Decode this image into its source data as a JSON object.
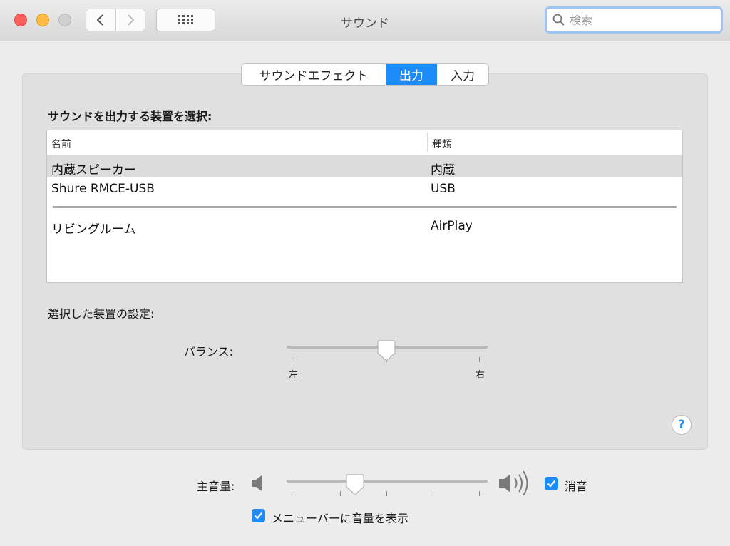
{
  "window": {
    "title": "サウンド"
  },
  "toolbar": {
    "search_placeholder": "検索"
  },
  "tabs": [
    {
      "label": "サウンドエフェクト",
      "selected": false
    },
    {
      "label": "出力",
      "selected": true
    },
    {
      "label": "入力",
      "selected": false
    }
  ],
  "output": {
    "heading": "サウンドを出力する装置を選択:",
    "columns": [
      "名前",
      "種類"
    ],
    "devices": [
      {
        "name": "内蔵スピーカー",
        "type": "内蔵",
        "selected": true
      },
      {
        "name": "Shure RMCE-USB",
        "type": "USB",
        "selected": false
      },
      {
        "name": "リビングルーム",
        "type": "AirPlay",
        "selected": false
      }
    ],
    "settings_heading": "選択した装置の設定:",
    "balance": {
      "label": "バランス:",
      "left_label": "左",
      "right_label": "右",
      "value": 0.5
    }
  },
  "help": {
    "label": "?"
  },
  "volume": {
    "label": "主音量:",
    "value": 0.33,
    "mute_label": "消音",
    "mute_checked": true
  },
  "menubar": {
    "label": "メニューバーに音量を表示",
    "checked": true
  },
  "colors": {
    "accent": "#1d8cf8",
    "close": "#fc605c",
    "minimize": "#fdbc40",
    "zoom": "#cfcfcf"
  }
}
